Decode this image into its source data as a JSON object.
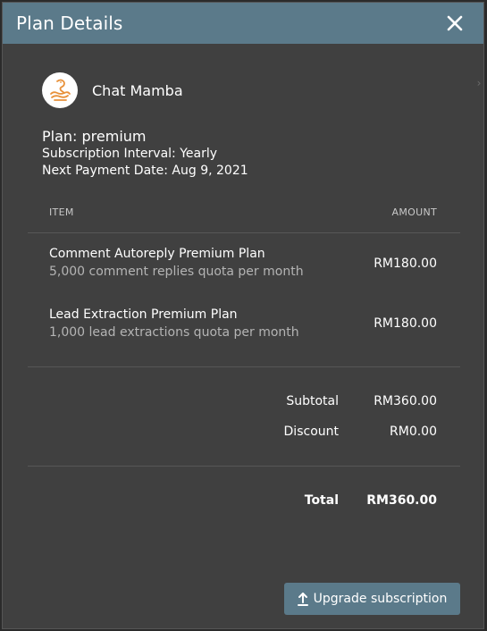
{
  "dialog": {
    "title": "Plan Details",
    "close_icon": "close-icon"
  },
  "app": {
    "name": "Chat Mamba",
    "logo_icon": "snake-logo-icon"
  },
  "plan": {
    "name_line": "Plan: premium",
    "interval_line": "Subscription Interval: Yearly",
    "next_payment_line": "Next Payment Date: Aug 9, 2021"
  },
  "table": {
    "headers": {
      "item": "ITEM",
      "amount": "AMOUNT"
    },
    "rows": [
      {
        "name": "Comment Autoreply Premium Plan",
        "description": "5,000 comment replies quota per month",
        "amount": "RM180.00"
      },
      {
        "name": "Lead Extraction Premium Plan",
        "description": "1,000 lead extractions quota per month",
        "amount": "RM180.00"
      }
    ]
  },
  "summary": {
    "subtotal_label": "Subtotal",
    "subtotal_value": "RM360.00",
    "discount_label": "Discount",
    "discount_value": "RM0.00",
    "total_label": "Total",
    "total_value": "RM360.00"
  },
  "actions": {
    "upgrade_label": "Upgrade subscription",
    "upgrade_icon": "upload-arrow-icon"
  },
  "colors": {
    "header_bg": "#5b7a8a",
    "modal_bg": "#404040",
    "logo_accent": "#e8913a"
  }
}
